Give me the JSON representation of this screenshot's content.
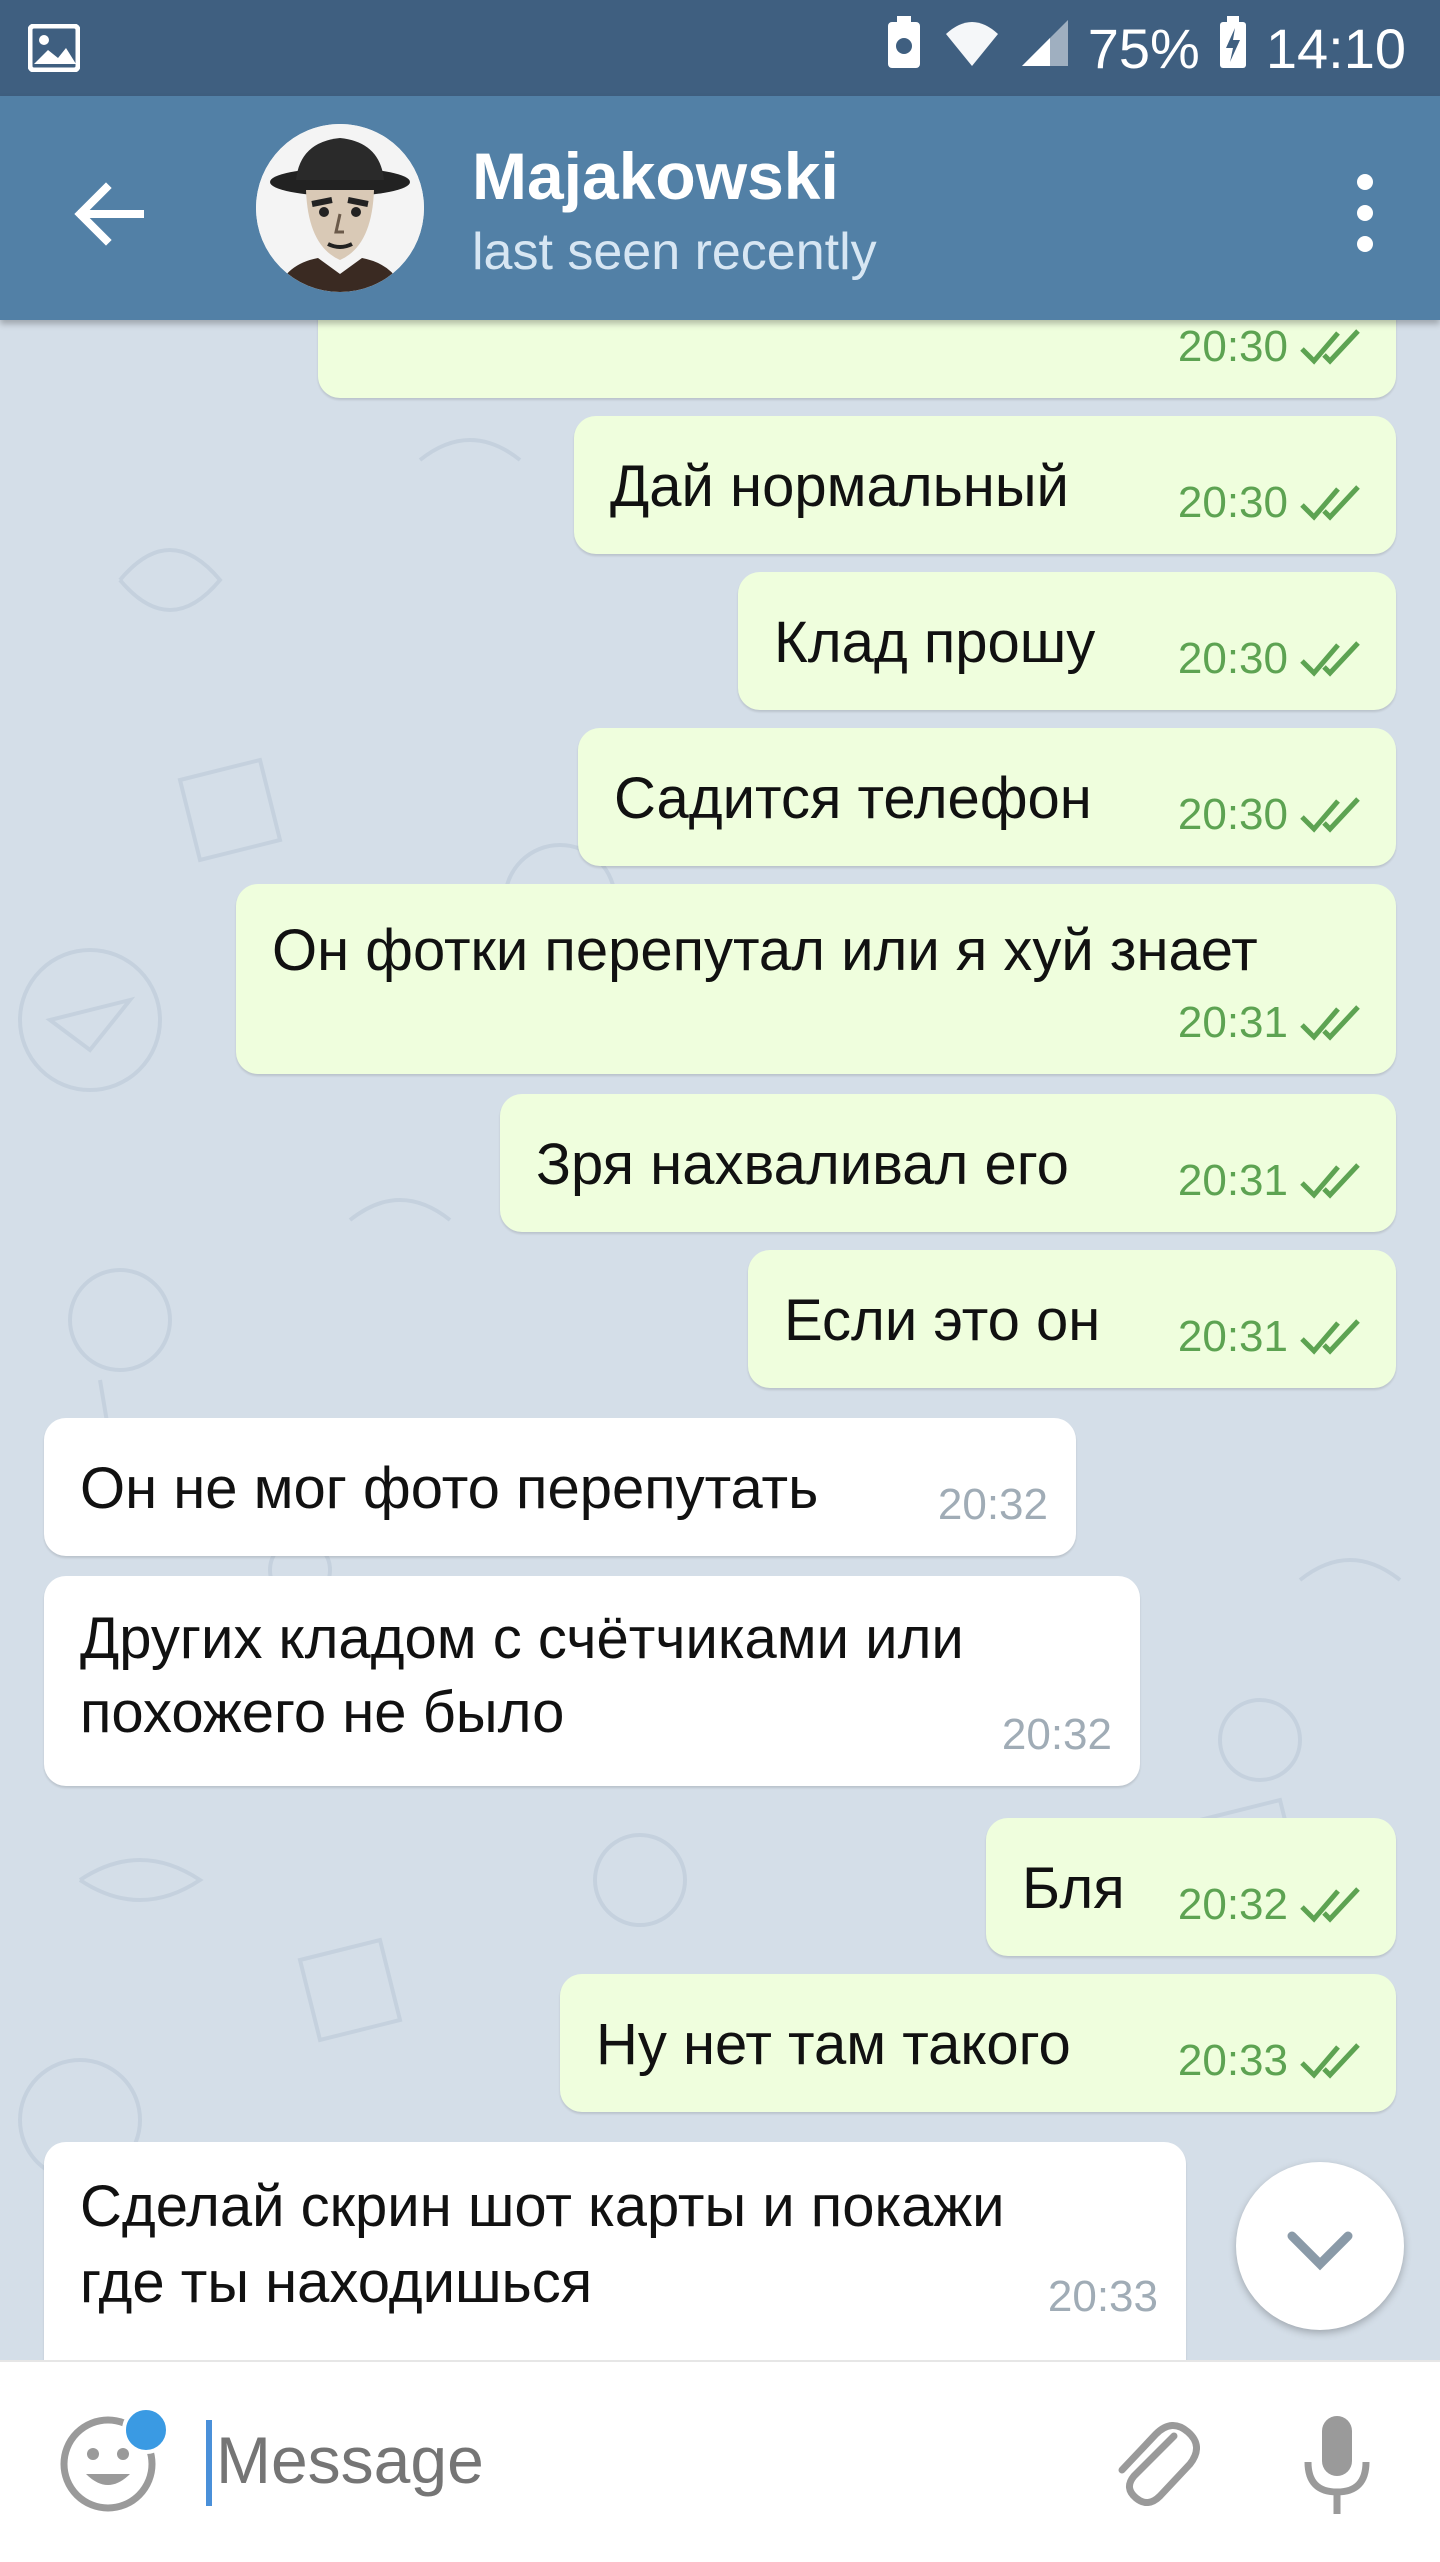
{
  "status_bar": {
    "battery": "75%",
    "time": "14:10"
  },
  "header": {
    "title": "Majakowski",
    "subtitle": "last seen recently"
  },
  "messages": [
    {
      "dir": "out",
      "text": "",
      "time": "20:30",
      "read": true
    },
    {
      "dir": "out",
      "text": "Дай нормальный",
      "time": "20:30",
      "read": true
    },
    {
      "dir": "out",
      "text": "Клад прошу",
      "time": "20:30",
      "read": true
    },
    {
      "dir": "out",
      "text": "Садится телефон",
      "time": "20:30",
      "read": true
    },
    {
      "dir": "out",
      "text": "Он фотки перепутал или я хуй знает",
      "time": "20:31",
      "read": true
    },
    {
      "dir": "out",
      "text": "Зря нахваливал его",
      "time": "20:31",
      "read": true
    },
    {
      "dir": "out",
      "text": "Если это он",
      "time": "20:31",
      "read": true
    },
    {
      "dir": "in",
      "text": "Он не мог фото перепутать",
      "time": "20:32"
    },
    {
      "dir": "in",
      "text_line1": "Других кладом с счётчиками или",
      "text_line2": "похожего не было",
      "time": "20:32"
    },
    {
      "dir": "out",
      "text": "Бля",
      "time": "20:32",
      "read": true
    },
    {
      "dir": "out",
      "text": "Ну нет там такого",
      "time": "20:33",
      "read": true
    },
    {
      "dir": "in",
      "text_line1": "Сделай скрин шот карты и покажи",
      "text_line2": "где ты находишься",
      "time": "20:33"
    }
  ],
  "input": {
    "placeholder": "Message"
  },
  "icons": {
    "status_left": "gallery-icon",
    "back": "arrow-left-icon",
    "menu": "more-vertical-icon",
    "emoji": "smile-icon",
    "attach": "paperclip-icon",
    "mic": "microphone-icon",
    "scroll": "chevron-down-icon"
  },
  "colors": {
    "header": "#5280a6",
    "statusbar": "#3f5f80",
    "outgoing_bubble": "#effedd",
    "incoming_bubble": "#ffffff",
    "tick_green": "#5da352"
  }
}
